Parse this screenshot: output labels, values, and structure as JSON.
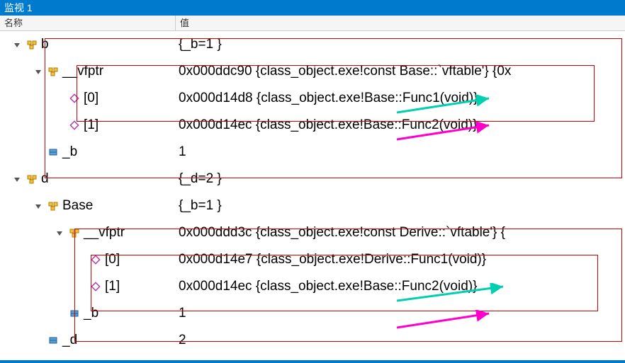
{
  "window": {
    "title": "监视 1"
  },
  "header": {
    "name": "名称",
    "value": "值"
  },
  "rows": [
    {
      "indent": 0,
      "exp": true,
      "icon": "class",
      "name": "b",
      "value": "{_b=1 }"
    },
    {
      "indent": 1,
      "exp": true,
      "icon": "class",
      "name": "__vfptr",
      "value": "0x000ddc90 {class_object.exe!const Base::`vftable'} {0x"
    },
    {
      "indent": 2,
      "exp": false,
      "icon": "method",
      "name": "[0]",
      "value": "0x000d14d8 {class_object.exe!Base::Func1(void)}"
    },
    {
      "indent": 2,
      "exp": false,
      "icon": "method",
      "name": "[1]",
      "value": "0x000d14ec {class_object.exe!Base::Func2(void)}"
    },
    {
      "indent": 1,
      "exp": false,
      "icon": "field",
      "name": "_b",
      "value": "1"
    },
    {
      "indent": 0,
      "exp": true,
      "icon": "class",
      "name": "d",
      "value": "{_d=2 }"
    },
    {
      "indent": 1,
      "exp": true,
      "icon": "class",
      "name": "Base",
      "value": "{_b=1 }"
    },
    {
      "indent": 2,
      "exp": true,
      "icon": "class",
      "name": "__vfptr",
      "value": "0x000ddd3c {class_object.exe!const Derive::`vftable'} {"
    },
    {
      "indent": 3,
      "exp": false,
      "icon": "method",
      "name": "[0]",
      "value": "0x000d14e7 {class_object.exe!Derive::Func1(void)}"
    },
    {
      "indent": 3,
      "exp": false,
      "icon": "method",
      "name": "[1]",
      "value": "0x000d14ec {class_object.exe!Base::Func2(void)}"
    },
    {
      "indent": 2,
      "exp": false,
      "icon": "field",
      "name": "_b",
      "value": "1"
    },
    {
      "indent": 1,
      "exp": false,
      "icon": "field",
      "name": "_d",
      "value": "2"
    }
  ]
}
